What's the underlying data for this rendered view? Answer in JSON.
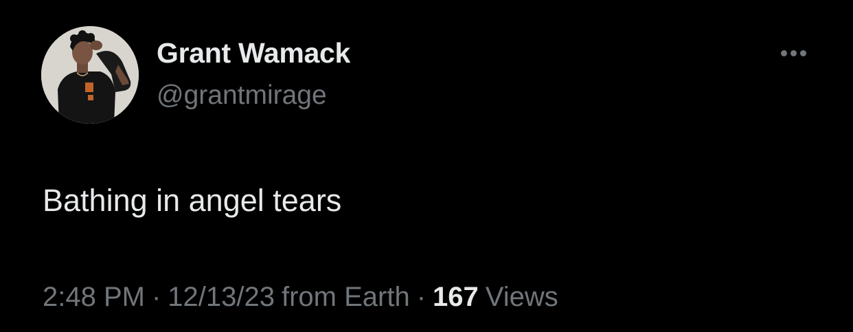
{
  "tweet": {
    "author": {
      "display_name": "Grant Wamack",
      "handle": "@grantmirage"
    },
    "text": "Bathing in angel tears",
    "time": "2:48 PM",
    "separator": "·",
    "date": "12/13/23",
    "source": "from Earth",
    "views_count": "167",
    "views_label": "Views"
  },
  "colors": {
    "background": "#000000",
    "primary_text": "#e7e9ea",
    "secondary_text": "#71767b"
  },
  "icons": {
    "more": "more-horizontal-icon"
  }
}
